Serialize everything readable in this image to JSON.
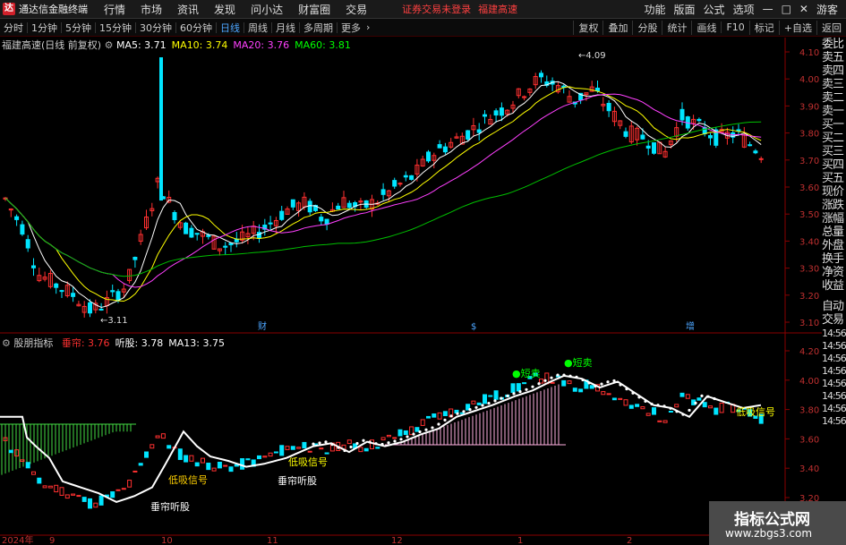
{
  "app": {
    "title": "通达信金融终端",
    "logo_text": "达"
  },
  "main_menu": [
    "行情",
    "市场",
    "资讯",
    "发现",
    "问小达",
    "财富圈",
    "交易"
  ],
  "notice": "证券交易未登录",
  "notice_stock": "福建高速",
  "right_menu": [
    "功能",
    "版面",
    "公式",
    "选项"
  ],
  "user": "游客",
  "toolbar": {
    "periods": [
      "分时",
      "1分钟",
      "5分钟",
      "15分钟",
      "30分钟",
      "60分钟",
      "日线",
      "周线",
      "月线",
      "多周期",
      "更多"
    ],
    "active": "日线",
    "right_tools": [
      "复权",
      "叠加",
      "分股",
      "统计",
      "画线",
      "F10",
      "标记",
      "+自选",
      "返回"
    ]
  },
  "main_chart": {
    "title": "福建高速(日线 前复权)",
    "ma": [
      {
        "label": "MA5: 3.71",
        "color": "#ffffff"
      },
      {
        "label": "MA10: 3.74",
        "color": "#ffff00"
      },
      {
        "label": "MA20: 3.76",
        "color": "#ff40ff"
      },
      {
        "label": "MA60: 3.81",
        "color": "#00ff00"
      }
    ],
    "y_ticks": [
      "4.10",
      "4.00",
      "3.90",
      "3.80",
      "3.70",
      "3.60",
      "3.50",
      "3.40",
      "3.30",
      "3.20",
      "3.10"
    ],
    "low_label": "3.11",
    "high_label": "4.09",
    "events": [
      "财",
      "$",
      "增"
    ]
  },
  "indicator": {
    "title": "股朋指标",
    "values": [
      {
        "label": "垂帘: 3.76",
        "color": "#ff3030"
      },
      {
        "label": "听股: 3.78",
        "color": "#ffffff"
      },
      {
        "label": "MA13: 3.75",
        "color": "#ffffff"
      }
    ],
    "y_ticks": [
      "4.20",
      "4.00",
      "3.80",
      "3.60",
      "3.40",
      "3.20"
    ],
    "signals": [
      "短卖",
      "短卖",
      "垂帘听股",
      "垂帘听股",
      "低吸信号",
      "低吸信号",
      "低吸信号"
    ]
  },
  "side_panel": [
    "委比",
    "卖五",
    "卖四",
    "卖三",
    "卖二",
    "卖一",
    "买一",
    "买二",
    "买三",
    "买四",
    "买五",
    "现价",
    "涨跌",
    "涨幅",
    "总量",
    "外盘",
    "换手",
    "净资",
    "收益",
    "自动",
    "交易"
  ],
  "side_times": [
    "14:56",
    "14:56",
    "14:56",
    "14:56",
    "14:56",
    "14:56",
    "14:56",
    "14:56"
  ],
  "dates": [
    "2024年",
    "9",
    "10",
    "11",
    "12",
    "1",
    "2"
  ],
  "watermark": {
    "cn": "指标公式网",
    "url": "www.zbgs3.com"
  }
}
